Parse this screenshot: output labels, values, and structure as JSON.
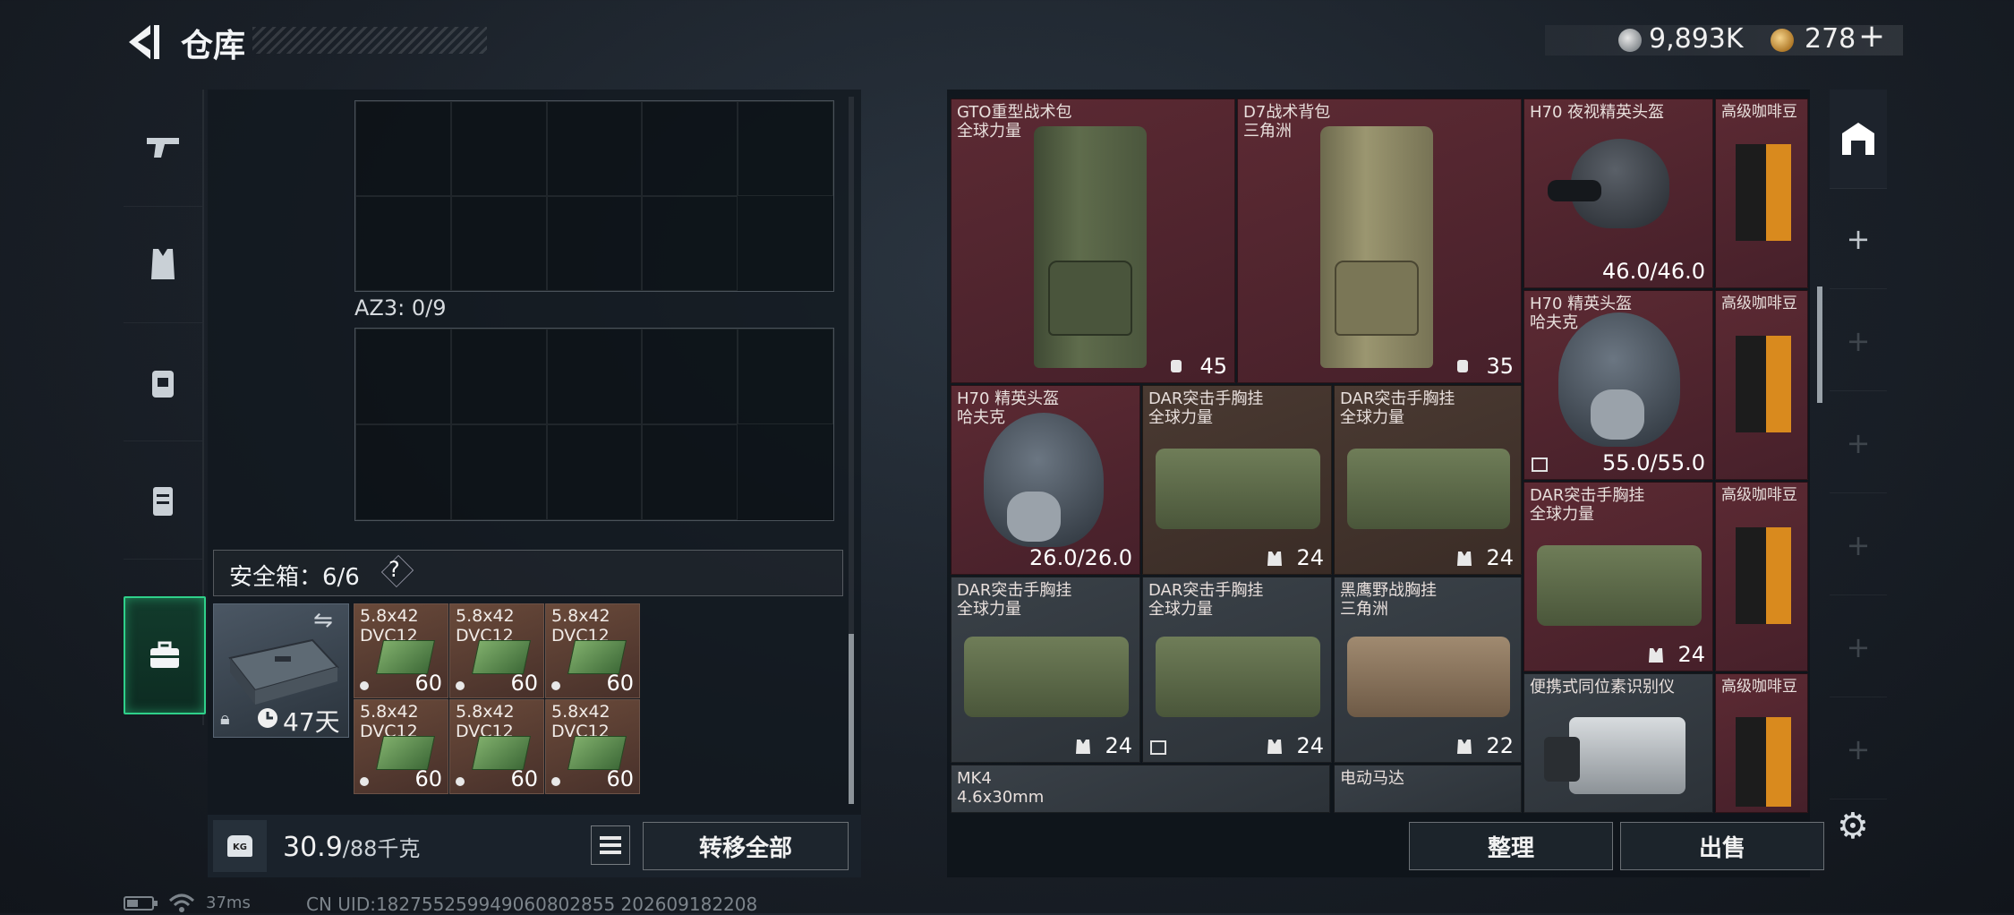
{
  "header": {
    "title": "仓库",
    "currency_silver": "9,893K",
    "currency_gold": "278",
    "plus": "+"
  },
  "left": {
    "az3_label": "AZ3: 0/9",
    "safe_label": "安全箱：6/6",
    "safe_help": "?",
    "case_days": "47天",
    "ammo": [
      {
        "name1": "5.8x42",
        "name2": "DVC12",
        "count": "60"
      },
      {
        "name1": "5.8x42",
        "name2": "DVC12",
        "count": "60"
      },
      {
        "name1": "5.8x42",
        "name2": "DVC12",
        "count": "60"
      },
      {
        "name1": "5.8x42",
        "name2": "DVC12",
        "count": "60"
      },
      {
        "name1": "5.8x42",
        "name2": "DVC12",
        "count": "60"
      },
      {
        "name1": "5.8x42",
        "name2": "DVC12",
        "count": "60"
      }
    ],
    "weight_value": "30.9",
    "weight_unit": "/88千克",
    "transfer_all": "转移全部"
  },
  "items": [
    {
      "name1": "GTO重型战术包",
      "name2": "全球力量",
      "value": "45"
    },
    {
      "name1": "D7战术背包",
      "name2": "三角洲",
      "value": "35"
    },
    {
      "name1": "H70 夜视精英头盔",
      "name2": "",
      "value": "46.0/46.0"
    },
    {
      "name1": "高级咖啡豆",
      "name2": "",
      "value": ""
    },
    {
      "name1": "H70 精英头盔",
      "name2": "哈夫克",
      "value": "55.0/55.0"
    },
    {
      "name1": "高级咖啡豆",
      "name2": "",
      "value": ""
    },
    {
      "name1": "H70 精英头盔",
      "name2": "哈夫克",
      "value": "26.0/26.0"
    },
    {
      "name1": "DAR突击手胸挂",
      "name2": "全球力量",
      "value": "24"
    },
    {
      "name1": "DAR突击手胸挂",
      "name2": "全球力量",
      "value": "24"
    },
    {
      "name1": "DAR突击手胸挂",
      "name2": "全球力量",
      "value": "24"
    },
    {
      "name1": "高级咖啡豆",
      "name2": "",
      "value": ""
    },
    {
      "name1": "DAR突击手胸挂",
      "name2": "全球力量",
      "value": "24"
    },
    {
      "name1": "DAR突击手胸挂",
      "name2": "全球力量",
      "value": "24"
    },
    {
      "name1": "黑鹰野战胸挂",
      "name2": "三角洲",
      "value": "22"
    },
    {
      "name1": "便携式同位素识别仪",
      "name2": "",
      "value": ""
    },
    {
      "name1": "高级咖啡豆",
      "name2": "",
      "value": ""
    },
    {
      "name1": "MK4",
      "name2": "4.6x30mm",
      "value": ""
    },
    {
      "name1": "电动马达",
      "name2": "",
      "value": ""
    }
  ],
  "footer": {
    "sort": "整理",
    "sell": "出售"
  },
  "status": {
    "ping": "37ms",
    "uid": "CN UID:182755259949060802855 202609182208"
  },
  "colors": {
    "accent_green": "#2fd08a",
    "item_red": "#5c2a33",
    "item_brown": "#4a3a32"
  }
}
